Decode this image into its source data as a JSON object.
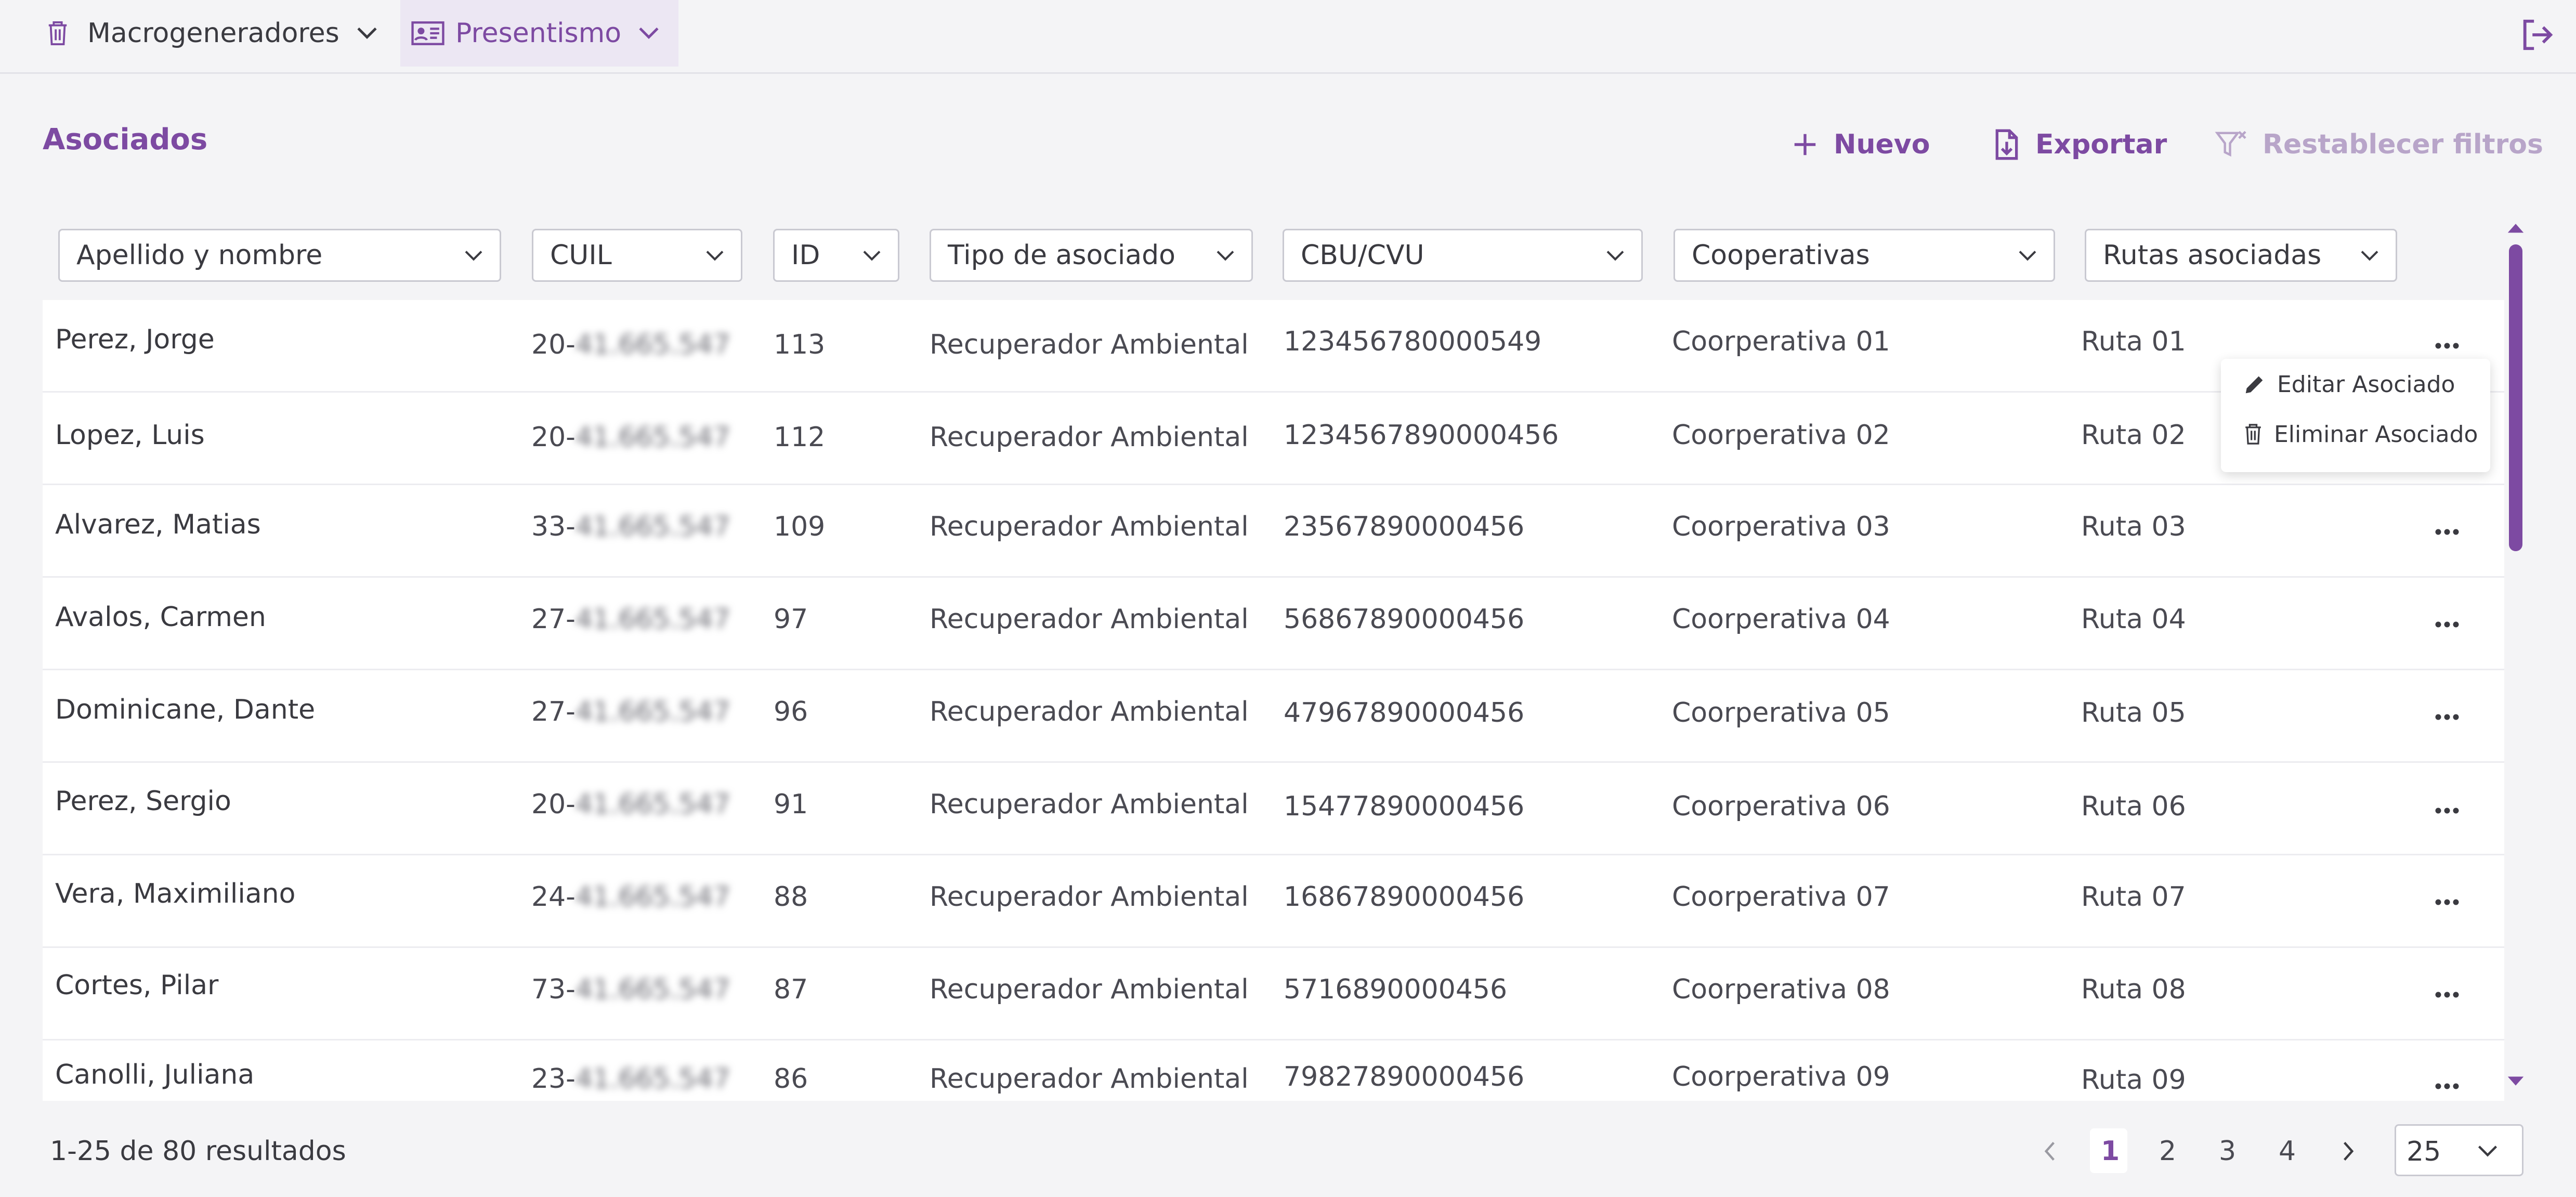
{
  "topnav": {
    "macro_label": "Macrogeneradores",
    "presentismo_label": "Presentismo"
  },
  "page": {
    "title": "Asociados",
    "new_label": "Nuevo",
    "export_label": "Exportar",
    "reset_label": "Restablecer filtros"
  },
  "filters": {
    "name": "Apellido y nombre",
    "cuil": "CUIL",
    "id": "ID",
    "type": "Tipo de asociado",
    "cbu": "CBU/CVU",
    "coop": "Cooperativas",
    "routes": "Rutas asociadas"
  },
  "rows": [
    {
      "name": "Perez, Jorge",
      "cuil_prefix": "20-",
      "cuil_hidden": "41.665.547",
      "id": "113",
      "type": "Recuperador Ambiental",
      "cbu": "123456780000549",
      "coop": "Coorperativa 01",
      "route": "Ruta 01"
    },
    {
      "name": "Lopez, Luis",
      "cuil_prefix": "20-",
      "cuil_hidden": "41.665.547",
      "id": "112",
      "type": "Recuperador Ambiental",
      "cbu": "1234567890000456",
      "coop": "Coorperativa 02",
      "route": "Ruta 02"
    },
    {
      "name": "Alvarez, Matias",
      "cuil_prefix": "33-",
      "cuil_hidden": "41.665.547",
      "id": "109",
      "type": "Recuperador Ambiental",
      "cbu": "23567890000456",
      "coop": "Coorperativa 03",
      "route": "Ruta 03"
    },
    {
      "name": "Avalos, Carmen",
      "cuil_prefix": "27-",
      "cuil_hidden": "41.665.547",
      "id": "97",
      "type": "Recuperador Ambiental",
      "cbu": "56867890000456",
      "coop": "Coorperativa 04",
      "route": "Ruta 04"
    },
    {
      "name": "Dominicane, Dante",
      "cuil_prefix": "27-",
      "cuil_hidden": "41.665.547",
      "id": "96",
      "type": "Recuperador Ambiental",
      "cbu": "47967890000456",
      "coop": "Coorperativa 05",
      "route": "Ruta 05"
    },
    {
      "name": "Perez, Sergio",
      "cuil_prefix": "20-",
      "cuil_hidden": "41.665.547",
      "id": "91",
      "type": "Recuperador Ambiental",
      "cbu": "15477890000456",
      "coop": "Coorperativa 06",
      "route": "Ruta 06"
    },
    {
      "name": "Vera, Maximiliano",
      "cuil_prefix": "24-",
      "cuil_hidden": "41.665.547",
      "id": "88",
      "type": "Recuperador Ambiental",
      "cbu": "16867890000456",
      "coop": "Coorperativa 07",
      "route": "Ruta 07"
    },
    {
      "name": "Cortes, Pilar",
      "cuil_prefix": "73-",
      "cuil_hidden": "41.665.547",
      "id": "87",
      "type": "Recuperador Ambiental",
      "cbu": "5716890000456",
      "coop": "Coorperativa 08",
      "route": "Ruta 08"
    },
    {
      "name": "Canolli, Juliana",
      "cuil_prefix": "23-",
      "cuil_hidden": "41.665.547",
      "id": "86",
      "type": "Recuperador Ambiental",
      "cbu": "79827890000456",
      "coop": "Coorperativa 09",
      "route": "Ruta 09"
    }
  ],
  "row_menu": {
    "edit_label": "Editar Asociado",
    "delete_label": "Eliminar Asociado"
  },
  "footer": {
    "results": "1-25 de 80 resultados",
    "pages": [
      "1",
      "2",
      "3",
      "4"
    ],
    "current_page": "1",
    "per_page": "25"
  },
  "colors": {
    "accent": "#7d4aa2",
    "accent_muted": "#b8a5c9",
    "background": "#f4f4f6"
  }
}
